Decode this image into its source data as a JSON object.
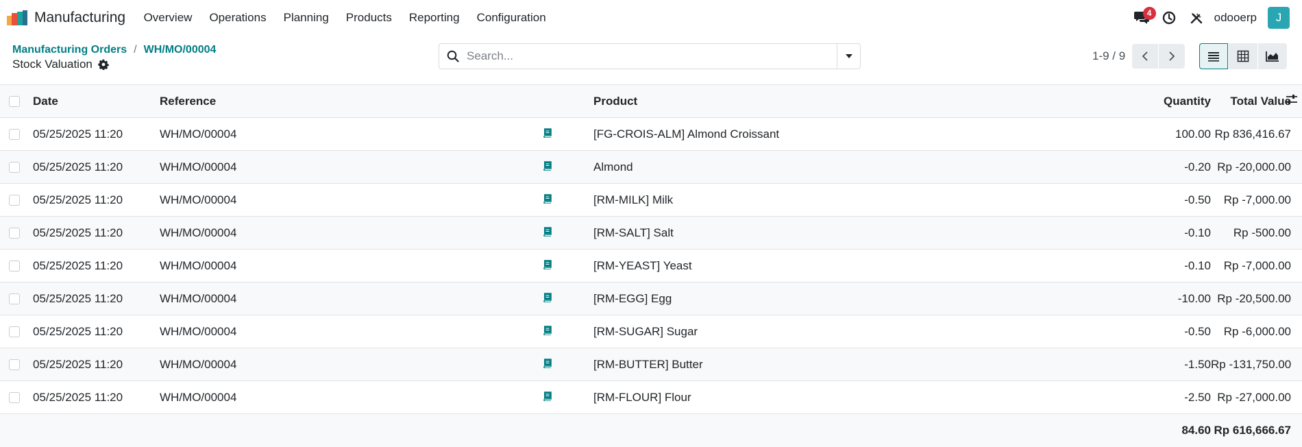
{
  "navbar": {
    "app_name": "Manufacturing",
    "menu": [
      "Overview",
      "Operations",
      "Planning",
      "Products",
      "Reporting",
      "Configuration"
    ],
    "messages_badge": "4",
    "db_name": "odooerp",
    "avatar_letter": "J",
    "icons": [
      "chat-icon",
      "clock-icon",
      "tools-icon"
    ]
  },
  "breadcrumb": {
    "parent": "Manufacturing Orders",
    "separator": "/",
    "current": "WH/MO/00004",
    "subtitle": "Stock Valuation"
  },
  "search": {
    "placeholder": "Search..."
  },
  "pager": {
    "value": "1-9 / 9"
  },
  "table": {
    "headers": {
      "date": "Date",
      "reference": "Reference",
      "product": "Product",
      "quantity": "Quantity",
      "total_value": "Total Value"
    },
    "rows": [
      {
        "date": "05/25/2025 11:20",
        "reference": "WH/MO/00004",
        "product": "[FG-CROIS-ALM] Almond Croissant",
        "quantity": "100.00",
        "total_value": "Rp 836,416.67"
      },
      {
        "date": "05/25/2025 11:20",
        "reference": "WH/MO/00004",
        "product": "Almond",
        "quantity": "-0.20",
        "total_value": "Rp -20,000.00"
      },
      {
        "date": "05/25/2025 11:20",
        "reference": "WH/MO/00004",
        "product": "[RM-MILK] Milk",
        "quantity": "-0.50",
        "total_value": "Rp -7,000.00"
      },
      {
        "date": "05/25/2025 11:20",
        "reference": "WH/MO/00004",
        "product": "[RM-SALT] Salt",
        "quantity": "-0.10",
        "total_value": "Rp -500.00"
      },
      {
        "date": "05/25/2025 11:20",
        "reference": "WH/MO/00004",
        "product": "[RM-YEAST] Yeast",
        "quantity": "-0.10",
        "total_value": "Rp -7,000.00"
      },
      {
        "date": "05/25/2025 11:20",
        "reference": "WH/MO/00004",
        "product": "[RM-EGG] Egg",
        "quantity": "-10.00",
        "total_value": "Rp -20,500.00"
      },
      {
        "date": "05/25/2025 11:20",
        "reference": "WH/MO/00004",
        "product": "[RM-SUGAR] Sugar",
        "quantity": "-0.50",
        "total_value": "Rp -6,000.00"
      },
      {
        "date": "05/25/2025 11:20",
        "reference": "WH/MO/00004",
        "product": "[RM-BUTTER] Butter",
        "quantity": "-1.50",
        "total_value": "Rp -131,750.00"
      },
      {
        "date": "05/25/2025 11:20",
        "reference": "WH/MO/00004",
        "product": "[RM-FLOUR] Flour",
        "quantity": "-2.50",
        "total_value": "Rp -27,000.00"
      }
    ],
    "totals": {
      "quantity": "84.60",
      "total_value": "Rp 616,666.67"
    }
  },
  "colors": {
    "accent": "#017e84",
    "badge": "#d9303e",
    "avatar": "#2aa6b2",
    "row_icon": "#017e84"
  }
}
